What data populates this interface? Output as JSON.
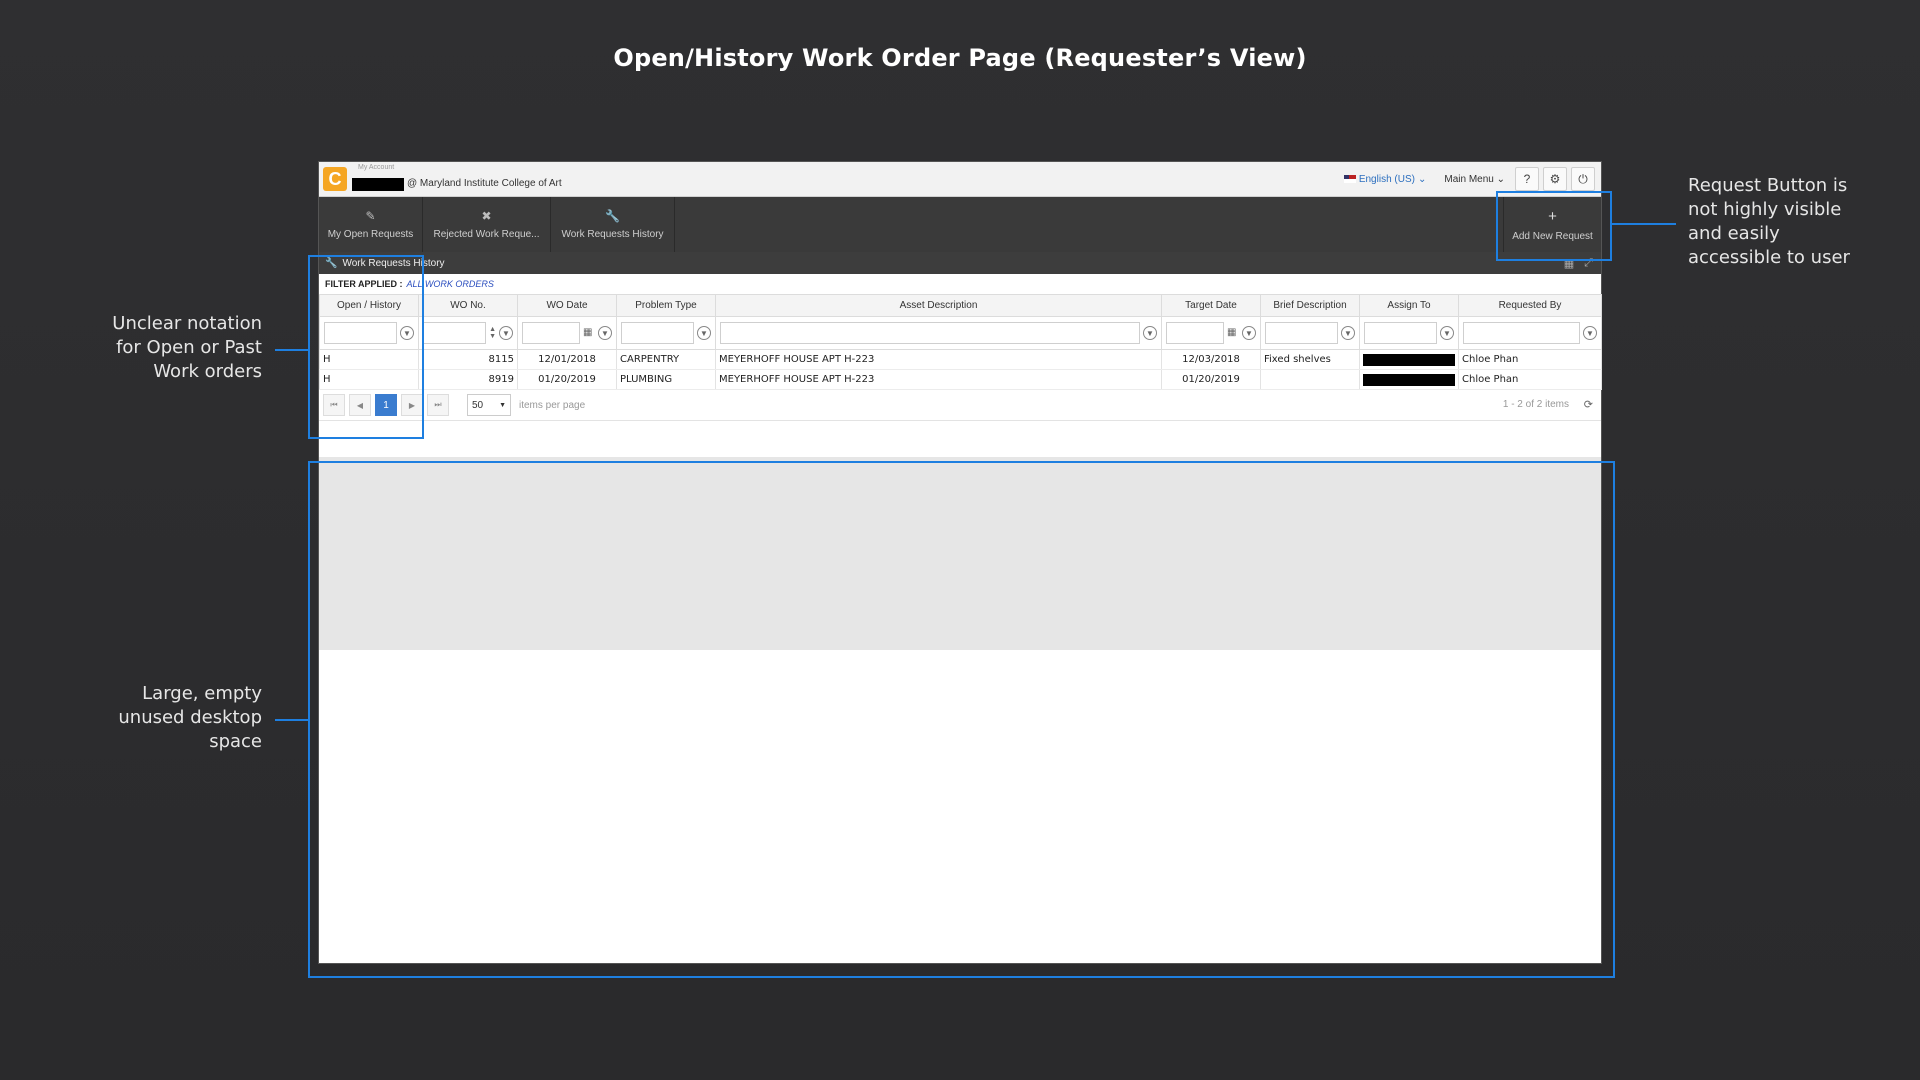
{
  "title": "Open/History Work Order Page (Requester’s View)",
  "annotations": {
    "open_history": [
      "Unclear notation",
      "for Open or Past",
      "Work orders"
    ],
    "empty_space": [
      "Large, empty",
      "unused desktop",
      "space"
    ],
    "request_button": [
      "Request Button is",
      "not highly visible",
      "and easily",
      "accessible to user"
    ]
  },
  "app": {
    "logo": "C",
    "account_label": "My Account",
    "org": "@ Maryland Institute College of Art",
    "language": "English (US)",
    "main_menu": "Main Menu",
    "nav": [
      {
        "label": "My Open Requests",
        "icon": "pencil-icon"
      },
      {
        "label": "Rejected Work Reque...",
        "icon": "x-icon"
      },
      {
        "label": "Work Requests History",
        "icon": "wrench-icon"
      }
    ],
    "add_new_request": "Add New Request",
    "panel_title": "Work Requests History",
    "filter_label": "FILTER APPLIED :",
    "filter_value": "ALL WORK ORDERS",
    "columns": [
      "Open / History",
      "WO No.",
      "WO Date",
      "Problem Type",
      "Asset Description",
      "Target Date",
      "Brief Description",
      "Assign To",
      "Requested By"
    ],
    "rows": [
      {
        "status": "H",
        "wo_no": "8115",
        "wo_date": "12/01/2018",
        "problem": "CARPENTRY",
        "asset": "MEYERHOFF HOUSE APT H-223",
        "target": "12/03/2018",
        "brief": "Fixed shelves",
        "requested_by": "Chloe Phan"
      },
      {
        "status": "H",
        "wo_no": "8919",
        "wo_date": "01/20/2019",
        "problem": "PLUMBING",
        "asset": "MEYERHOFF HOUSE APT H-223",
        "target": "01/20/2019",
        "brief": "",
        "requested_by": "Chloe Phan"
      }
    ],
    "pager": {
      "current_page": "1",
      "per_page": "50",
      "per_page_label": "items per page",
      "info": "1 - 2 of 2 items"
    }
  },
  "colors": {
    "highlight": "#1e7fe0",
    "logo": "#f5a623",
    "active_page": "#3a7ccf"
  }
}
